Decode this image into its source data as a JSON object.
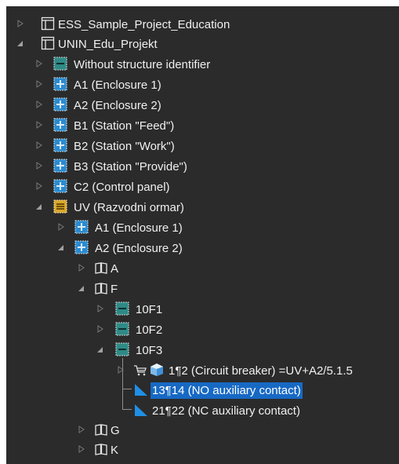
{
  "tree": {
    "project1": "ESS_Sample_Project_Education",
    "project2": "UNIN_Edu_Projekt",
    "without_structure": "Without structure identifier",
    "a1": "A1 (Enclosure 1)",
    "a2": "A2 (Enclosure 2)",
    "b1": "B1 (Station \"Feed\")",
    "b2": "B2 (Station \"Work\")",
    "b3": "B3 (Station \"Provide\")",
    "c2": "C2 (Control panel)",
    "uv": "UV (Razvodni ormar)",
    "uv_a1": "A1 (Enclosure 1)",
    "uv_a2": "A2 (Enclosure 2)",
    "book_a": "A",
    "book_f": "F",
    "f1": "10F1",
    "f2": "10F2",
    "f3": "10F3",
    "cb": "1¶2 (Circuit breaker) =UV+A2/5.1.5",
    "no_contact": "13¶14 (NO auxiliary contact)",
    "nc_contact": "21¶22 (NC auxiliary contact)",
    "book_g": "G",
    "book_k": "K"
  },
  "icons": {
    "project": "project-table-icon",
    "location_teal": "location-teal-icon",
    "location_blue": "location-blue-icon",
    "location_yellow": "location-yellow-icon",
    "book": "book-icon",
    "cart": "cart-icon",
    "cube": "cube-icon",
    "contact": "contact-triangle-icon"
  },
  "colors": {
    "background": "#2b2b2b",
    "text": "#f0f0f0",
    "selection": "#1769c4",
    "teal_icon": "#2f8a86",
    "blue_icon": "#2a8bd0",
    "yellow_icon": "#d8a72a",
    "contact_icon": "#1f8fe6"
  }
}
